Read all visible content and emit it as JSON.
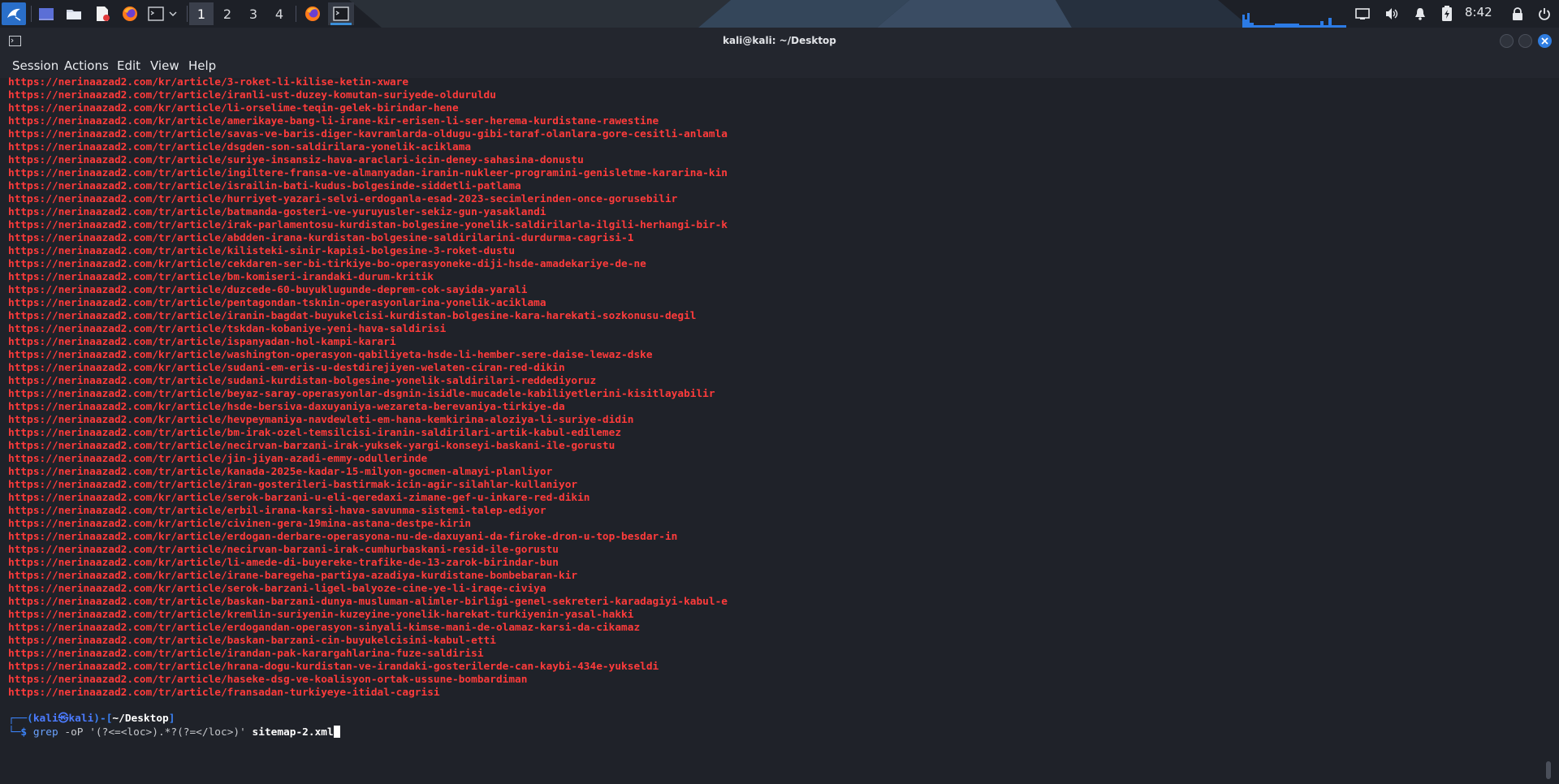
{
  "panel": {
    "workspaces": [
      "1",
      "2",
      "3",
      "4"
    ],
    "active_workspace": "1",
    "clock": "8:42",
    "icons": [
      "kali-menu-icon",
      "show-desktop-icon",
      "file-manager-icon",
      "text-editor-icon",
      "firefox-icon",
      "terminal-icon",
      "terminal-dropdown-icon",
      "firefox-task-icon",
      "terminal-task-icon",
      "cpu-graph-icon",
      "display-icon",
      "volume-icon",
      "notification-bell-icon",
      "battery-icon",
      "lock-icon",
      "power-icon"
    ],
    "accent_color": "#3b8fd9"
  },
  "window": {
    "title": "kali@kali: ~/Desktop",
    "menu": [
      "Session",
      "Actions",
      "Edit",
      "View",
      "Help"
    ]
  },
  "terminal": {
    "output_color": "#ff3b3b",
    "lines": [
      "https://nerinaazad2.com/kr/article/3-roket-li-kilise-ketin-xware",
      "https://nerinaazad2.com/tr/article/iranli-ust-duzey-komutan-suriyede-olduruldu",
      "https://nerinaazad2.com/kr/article/li-orselime-teqin-gelek-birindar-hene",
      "https://nerinaazad2.com/kr/article/amerikaye-bang-li-irane-kir-erisen-li-ser-herema-kurdistane-rawestine",
      "https://nerinaazad2.com/tr/article/savas-ve-baris-diger-kavramlarda-oldugu-gibi-taraf-olanlara-gore-cesitli-anlamla",
      "https://nerinaazad2.com/tr/article/dsgden-son-saldirilara-yonelik-aciklama",
      "https://nerinaazad2.com/tr/article/suriye-insansiz-hava-araclari-icin-deney-sahasina-donustu",
      "https://nerinaazad2.com/tr/article/ingiltere-fransa-ve-almanyadan-iranin-nukleer-programini-genisletme-kararina-kin",
      "https://nerinaazad2.com/tr/article/israilin-bati-kudus-bolgesinde-siddetli-patlama",
      "https://nerinaazad2.com/tr/article/hurriyet-yazari-selvi-erdoganla-esad-2023-secimlerinden-once-gorusebilir",
      "https://nerinaazad2.com/tr/article/batmanda-gosteri-ve-yuruyusler-sekiz-gun-yasaklandi",
      "https://nerinaazad2.com/tr/article/irak-parlamentosu-kurdistan-bolgesine-yonelik-saldirilarla-ilgili-herhangi-bir-k",
      "https://nerinaazad2.com/tr/article/abdden-irana-kurdistan-bolgesine-saldirilarini-durdurma-cagrisi-1",
      "https://nerinaazad2.com/tr/article/kilisteki-sinir-kapisi-bolgesine-3-roket-dustu",
      "https://nerinaazad2.com/kr/article/cekdaren-ser-bi-tirkiye-bo-operasyoneke-diji-hsde-amadekariye-de-ne",
      "https://nerinaazad2.com/tr/article/bm-komiseri-irandaki-durum-kritik",
      "https://nerinaazad2.com/tr/article/duzcede-60-buyuklugunde-deprem-cok-sayida-yarali",
      "https://nerinaazad2.com/tr/article/pentagondan-tsknin-operasyonlarina-yonelik-aciklama",
      "https://nerinaazad2.com/tr/article/iranin-bagdat-buyukelcisi-kurdistan-bolgesine-kara-harekati-sozkonusu-degil",
      "https://nerinaazad2.com/tr/article/tskdan-kobaniye-yeni-hava-saldirisi",
      "https://nerinaazad2.com/tr/article/ispanyadan-hol-kampi-karari",
      "https://nerinaazad2.com/kr/article/washington-operasyon-qabiliyeta-hsde-li-hember-sere-daise-lewaz-dske",
      "https://nerinaazad2.com/kr/article/sudani-em-eris-u-destdirejiyen-welaten-ciran-red-dikin",
      "https://nerinaazad2.com/tr/article/sudani-kurdistan-bolgesine-yonelik-saldirilari-reddediyoruz",
      "https://nerinaazad2.com/tr/article/beyaz-saray-operasyonlar-dsgnin-isidle-mucadele-kabiliyetlerini-kisitlayabilir",
      "https://nerinaazad2.com/kr/article/hsde-bersiva-daxuyaniya-wezareta-berevaniya-tirkiye-da",
      "https://nerinaazad2.com/kr/article/hevpeymaniya-navdewleti-em-hana-kemkirina-aloziya-li-suriye-didin",
      "https://nerinaazad2.com/tr/article/bm-irak-ozel-temsilcisi-iranin-saldirilari-artik-kabul-edilemez",
      "https://nerinaazad2.com/tr/article/necirvan-barzani-irak-yuksek-yargi-konseyi-baskani-ile-gorustu",
      "https://nerinaazad2.com/tr/article/jin-jiyan-azadi-emmy-odullerinde",
      "https://nerinaazad2.com/tr/article/kanada-2025e-kadar-15-milyon-gocmen-almayi-planliyor",
      "https://nerinaazad2.com/tr/article/iran-gosterileri-bastirmak-icin-agir-silahlar-kullaniyor",
      "https://nerinaazad2.com/kr/article/serok-barzani-u-eli-qeredaxi-zimane-gef-u-inkare-red-dikin",
      "https://nerinaazad2.com/tr/article/erbil-irana-karsi-hava-savunma-sistemi-talep-ediyor",
      "https://nerinaazad2.com/kr/article/civinen-gera-19mina-astana-destpe-kirin",
      "https://nerinaazad2.com/kr/article/erdogan-derbare-operasyona-nu-de-daxuyani-da-firoke-dron-u-top-besdar-in",
      "https://nerinaazad2.com/tr/article/necirvan-barzani-irak-cumhurbaskani-resid-ile-gorustu",
      "https://nerinaazad2.com/kr/article/li-amede-di-buyereke-trafike-de-13-zarok-birindar-bun",
      "https://nerinaazad2.com/kr/article/irane-baregeha-partiya-azadiya-kurdistane-bombebaran-kir",
      "https://nerinaazad2.com/kr/article/serok-barzani-ligel-balyoze-cine-ye-li-iraqe-civiya",
      "https://nerinaazad2.com/tr/article/baskan-barzani-dunya-musluman-alimler-birligi-genel-sekreteri-karadagiyi-kabul-e",
      "https://nerinaazad2.com/tr/article/kremlin-suriyenin-kuzeyine-yonelik-harekat-turkiyenin-yasal-hakki",
      "https://nerinaazad2.com/tr/article/erdogandan-operasyon-sinyali-kimse-mani-de-olamaz-karsi-da-cikamaz",
      "https://nerinaazad2.com/tr/article/baskan-barzani-cin-buyukelcisini-kabul-etti",
      "https://nerinaazad2.com/tr/article/irandan-pak-karargahlarina-fuze-saldirisi",
      "https://nerinaazad2.com/tr/article/hrana-dogu-kurdistan-ve-irandaki-gosterilerde-can-kaybi-434e-yukseldi",
      "https://nerinaazad2.com/tr/article/haseke-dsg-ve-koalisyon-ortak-ussune-bombardiman",
      "https://nerinaazad2.com/tr/article/fransadan-turkiyeye-itidal-cagrisi"
    ],
    "prompt": {
      "corner_top": "┌──(",
      "user": "kali",
      "at": "㉿",
      "host": "kali",
      "sep": ")-[",
      "path": "~/Desktop",
      "close": "]",
      "corner_bottom": "└─",
      "dollar": "$",
      "command": "grep",
      "args_grey": " -oP '(?<=<loc>).*?(?=</loc>)' ",
      "args_white": "sitemap-2.xml"
    }
  }
}
